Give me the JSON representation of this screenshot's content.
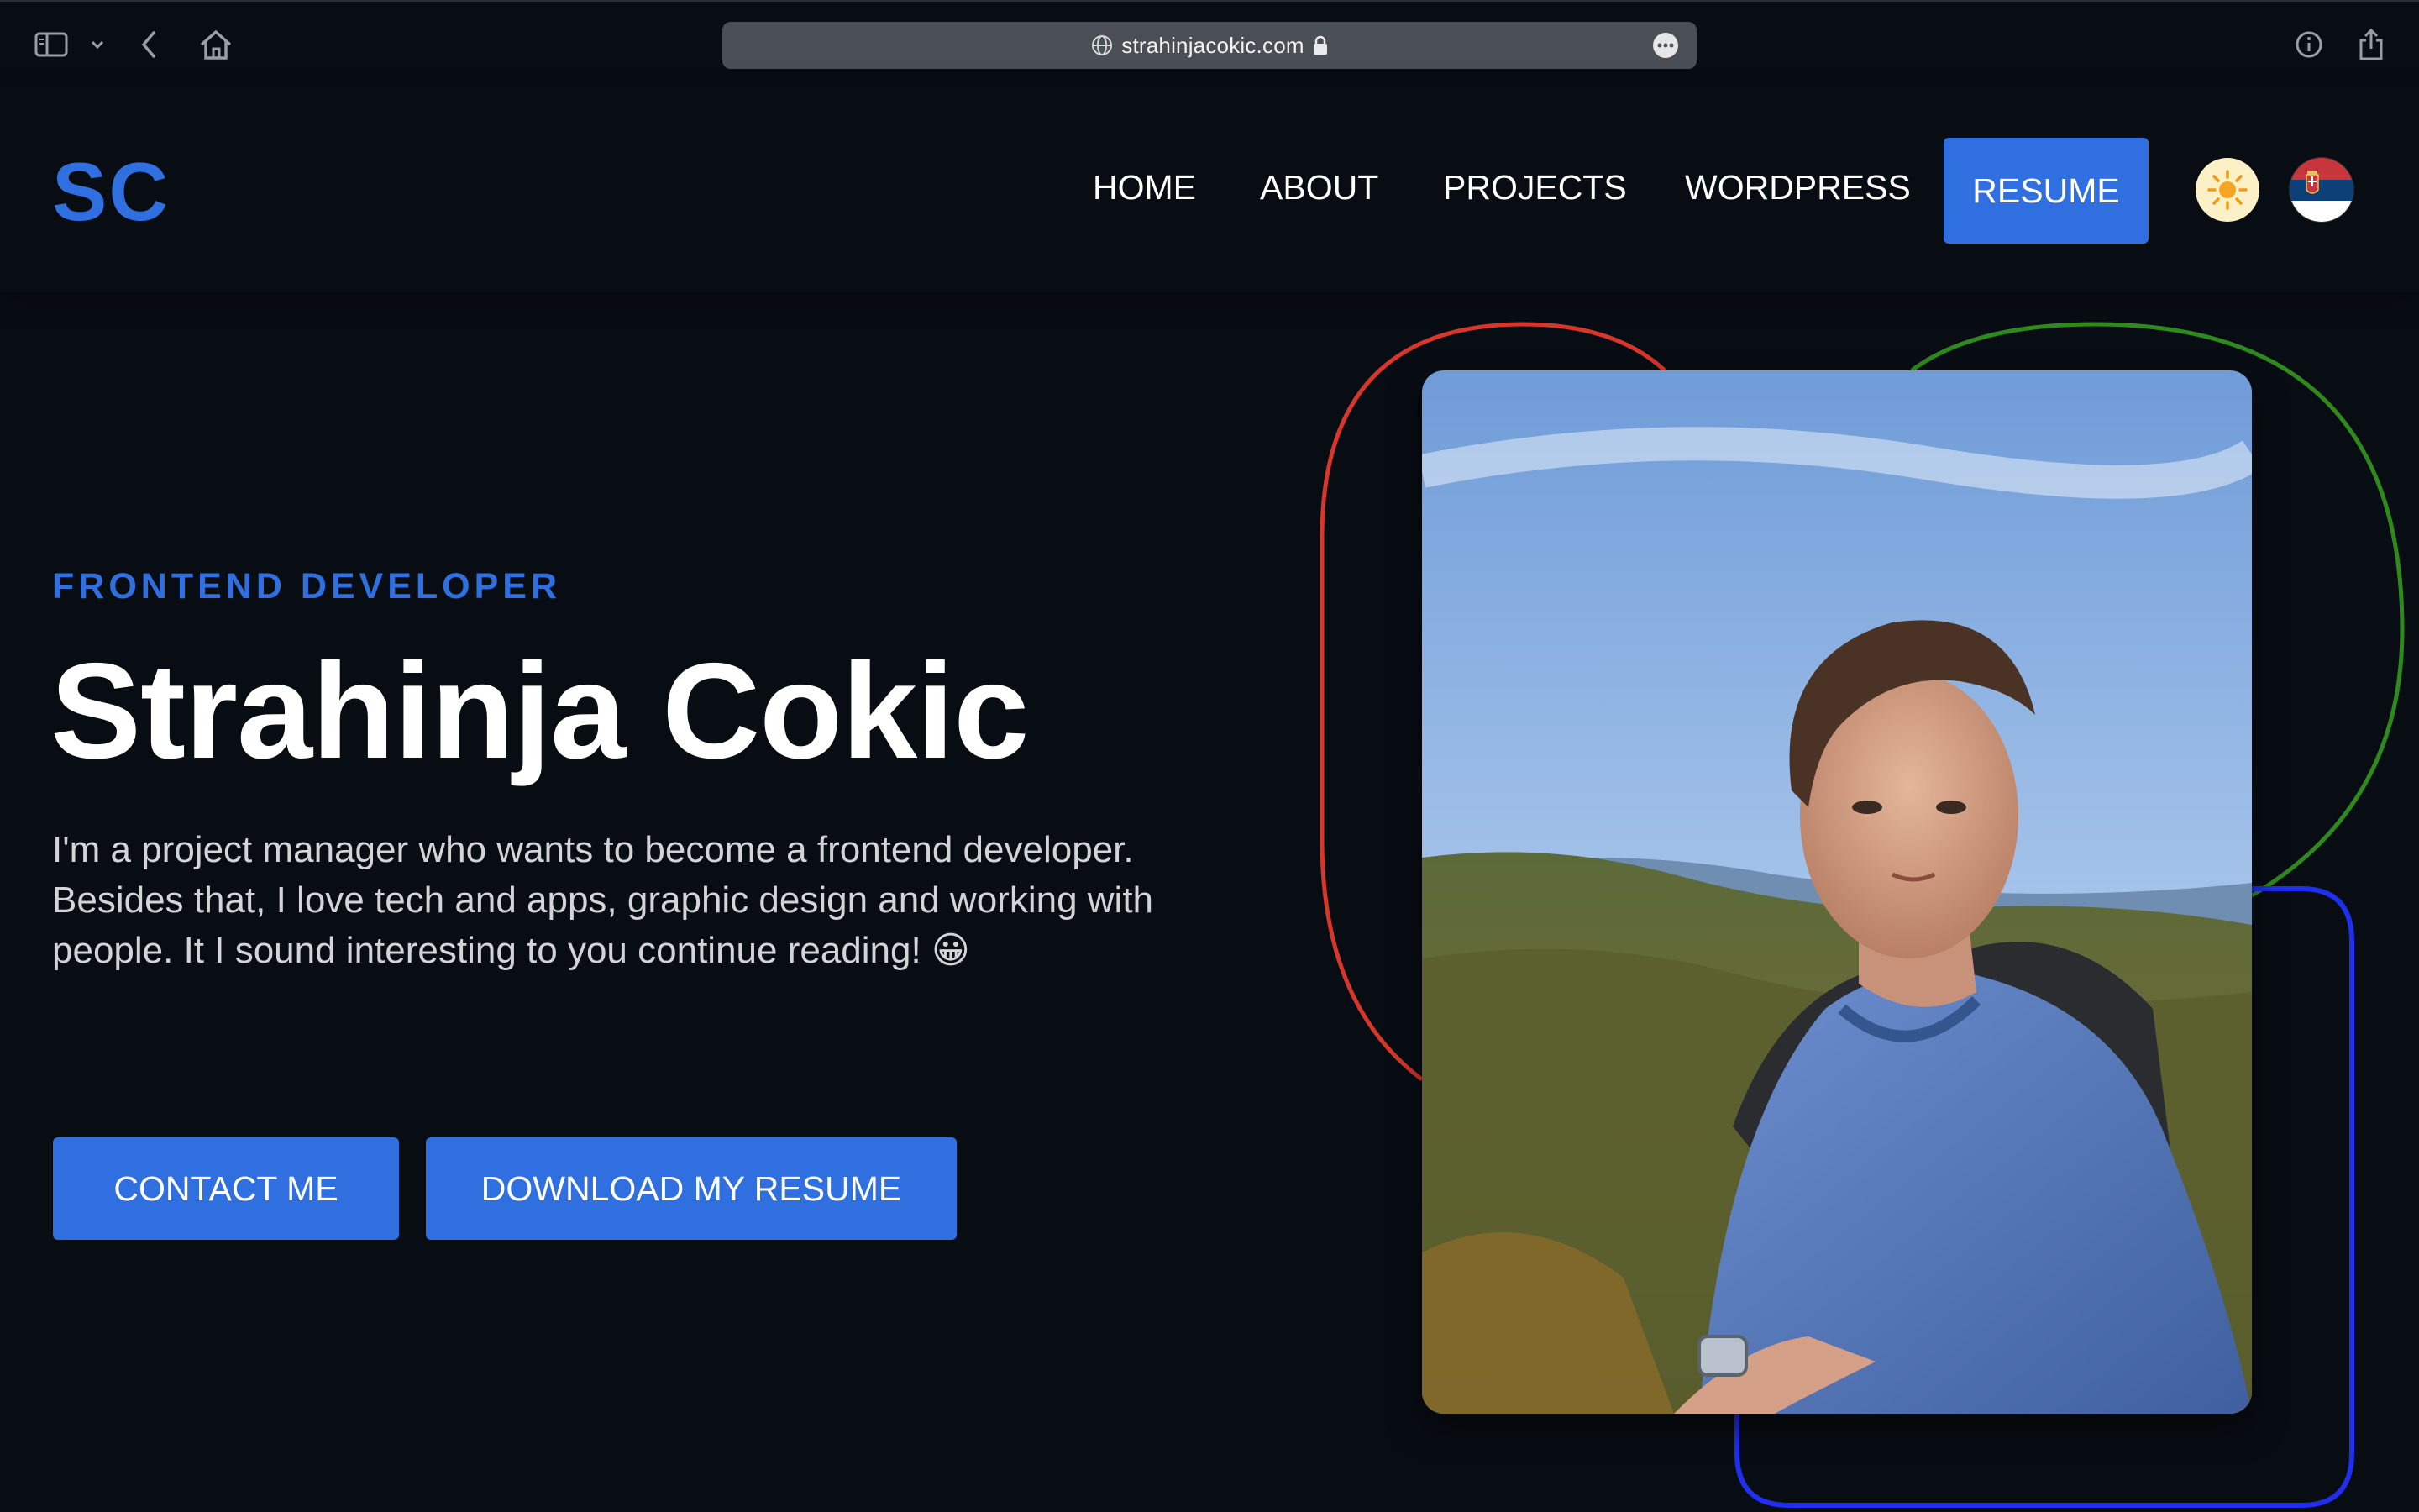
{
  "browser": {
    "url": "strahinjacokic.com",
    "icons": [
      "sidebar-icon",
      "chevron-down-icon",
      "back-arrow-icon",
      "home-icon",
      "globe-icon",
      "lock-icon",
      "more-icon",
      "info-icon",
      "share-icon"
    ]
  },
  "header": {
    "logo": "SC",
    "nav": [
      "HOME",
      "ABOUT",
      "PROJECTS",
      "WORDPRESS"
    ],
    "resume_label": "RESUME",
    "theme_icon": "sun-icon",
    "language_icon": "serbian-flag-icon"
  },
  "hero": {
    "eyebrow": "FRONTEND DEVELOPER",
    "name": "Strahinja Cokic",
    "description": "I'm a project manager who wants to become a frontend developer. Besides that, I love tech and apps, graphic design and working with people. It I sound interesting to you continue reading! 😀",
    "buttons": {
      "contact": "CONTACT ME",
      "download": "DOWNLOAD MY RESUME"
    }
  },
  "colors": {
    "background": "#080d14",
    "accent": "#2f6fe0",
    "ring_red": "#d8362a",
    "ring_green": "#2f8a1e",
    "ring_blue": "#1f2ff0"
  }
}
